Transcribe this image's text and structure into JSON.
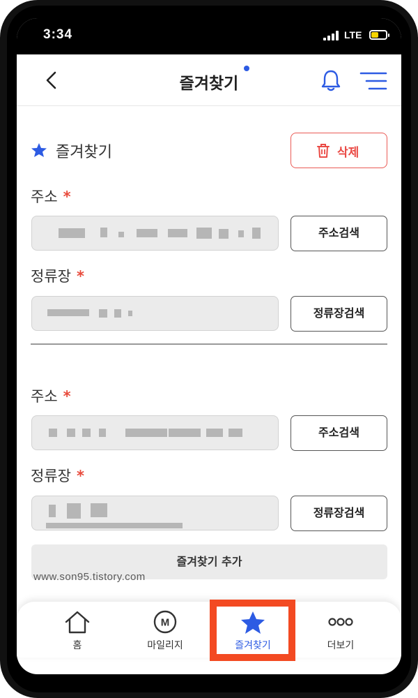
{
  "status_bar": {
    "time": "3:34",
    "network": "LTE"
  },
  "header": {
    "title": "즐겨찾기"
  },
  "section": {
    "title": "즐겨찾기",
    "delete_label": "삭제"
  },
  "entries": [
    {
      "address_label": "주소",
      "address_search_label": "주소검색",
      "stop_label": "정류장",
      "stop_search_label": "정류장검색"
    },
    {
      "address_label": "주소",
      "address_search_label": "주소검색",
      "stop_label": "정류장",
      "stop_search_label": "정류장검색"
    }
  ],
  "required_mark": "*",
  "add_label": "즐겨찾기 추가",
  "watermark": "www.son95.tistory.com",
  "tabbar": {
    "tabs": [
      {
        "label": "홈",
        "icon": "home-icon"
      },
      {
        "label": "마일리지",
        "icon": "mileage-icon"
      },
      {
        "label": "즐겨찾기",
        "icon": "star-icon"
      },
      {
        "label": "더보기",
        "icon": "more-icon"
      }
    ],
    "active_index": 2
  },
  "colors": {
    "accent": "#2d5be3",
    "danger": "#ea4a45",
    "highlight": "#f34a22",
    "required": "#e84b3c"
  }
}
